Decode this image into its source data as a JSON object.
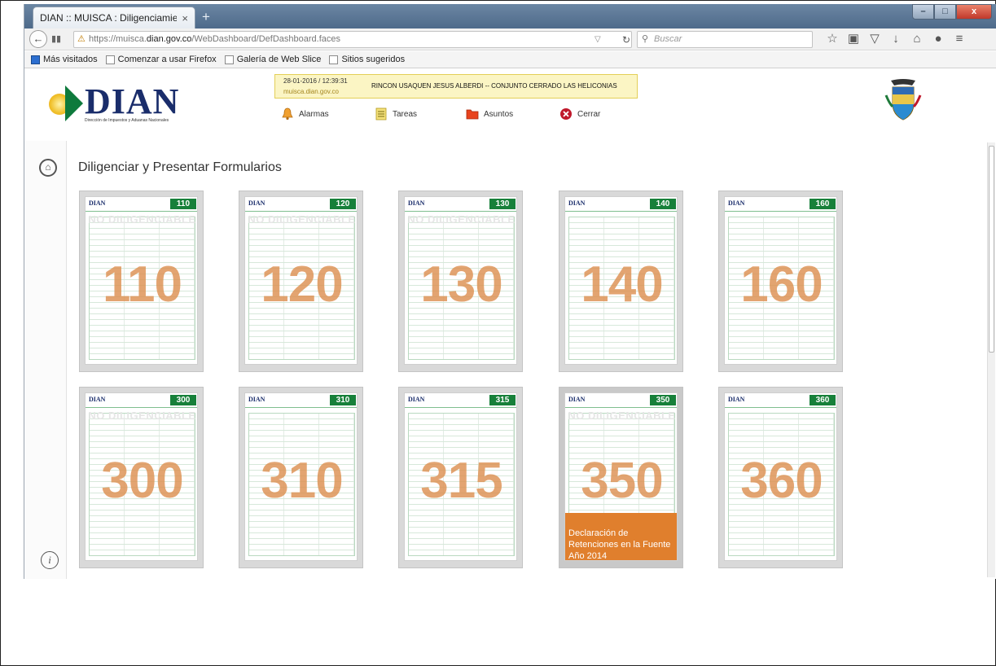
{
  "browser": {
    "tab_title": "DIAN :: MUISCA : Diligenciamie...",
    "tab_close": "×",
    "new_tab": "+",
    "url_prefix": "https://muisca.",
    "url_domain": "dian.gov.co",
    "url_path": "/WebDashboard/DefDashboard.faces",
    "search_placeholder": "Buscar",
    "window_controls": [
      "–",
      "□",
      "x"
    ]
  },
  "bookmarks": [
    "Más visitados",
    "Comenzar a usar Firefox",
    "Galería de Web Slice",
    "Sitios sugeridos"
  ],
  "header": {
    "logo_text": "DIAN",
    "logo_subtitle": "Dirección de Impuestos y Aduanas Nacionales",
    "datetime": "28-01-2016 / 12:39:31",
    "host": "muisca.dian.gov.co",
    "user": "RINCON USAQUEN JESUS ALBERDI -- CONJUNTO CERRADO LAS HELICONIAS",
    "menu": {
      "alarmas": "Alarmas",
      "tareas": "Tareas",
      "asuntos": "Asuntos",
      "cerrar": "Cerrar"
    }
  },
  "main": {
    "title": "Diligenciar y Presentar Formularios",
    "forms": [
      {
        "code": "110",
        "watermark": "NO DILIGENCIABLE"
      },
      {
        "code": "120",
        "watermark": "NO DILIGENCIABLE"
      },
      {
        "code": "130",
        "watermark": "NO DILIGENCIABLE"
      },
      {
        "code": "140",
        "watermark": ""
      },
      {
        "code": "160",
        "watermark": ""
      },
      {
        "code": "300",
        "watermark": "NO DILIGENCIABLE"
      },
      {
        "code": "310",
        "watermark": ""
      },
      {
        "code": "315",
        "watermark": ""
      },
      {
        "code": "350",
        "watermark": "NO DILIGENCIABLE",
        "caption": "Declaración de Retenciones en la Fuente Año 2014"
      },
      {
        "code": "360",
        "watermark": ""
      }
    ]
  },
  "colors": {
    "accent_orange": "#e07f2d",
    "form_green": "#17803a",
    "dian_blue": "#1a2d6b"
  }
}
